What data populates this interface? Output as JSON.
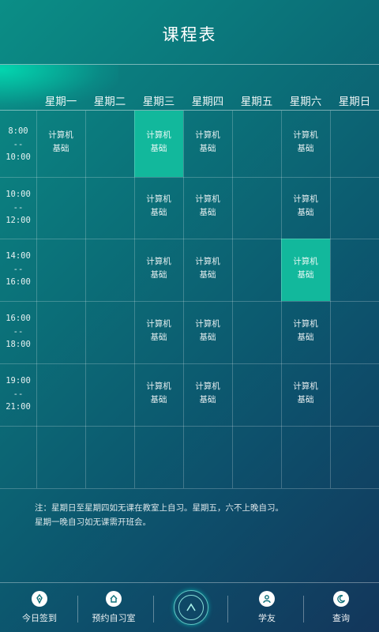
{
  "header": {
    "title": "课程表"
  },
  "days": [
    "星期一",
    "星期二",
    "星期三",
    "星期四",
    "星期五",
    "星期六",
    "星期日"
  ],
  "times": [
    {
      "start": "8:00",
      "sep": "--",
      "end": "10:00"
    },
    {
      "start": "10:00",
      "sep": "--",
      "end": "12:00"
    },
    {
      "start": "14:00",
      "sep": "--",
      "end": "16:00"
    },
    {
      "start": "16:00",
      "sep": "--",
      "end": "18:00"
    },
    {
      "start": "19:00",
      "sep": "--",
      "end": "21:00"
    }
  ],
  "course": {
    "line1": "计算机",
    "line2": "基础"
  },
  "schedule": {
    "row0": [
      "course",
      "",
      "course-highlight",
      "course",
      "",
      "course",
      ""
    ],
    "row1": [
      "",
      "",
      "course",
      "course",
      "",
      "course",
      ""
    ],
    "row2": [
      "",
      "",
      "course",
      "course",
      "",
      "course-highlight",
      ""
    ],
    "row3": [
      "",
      "",
      "course",
      "course",
      "",
      "course",
      ""
    ],
    "row4": [
      "",
      "",
      "course",
      "course",
      "",
      "course",
      ""
    ]
  },
  "note": {
    "line1": "注：星期日至星期四如无课在教室上自习。星期五，六不上晚自习。",
    "line2": "星期一晚自习如无课需开班会。"
  },
  "tabbar": {
    "checkin": {
      "label": "今日签到",
      "icon": "pen-icon"
    },
    "reserve": {
      "label": "预约自习室",
      "icon": "home-icon"
    },
    "center": {
      "icon": "chevron-up-icon"
    },
    "friends": {
      "label": "学友",
      "icon": "person-icon"
    },
    "query": {
      "label": "查询",
      "icon": "moon-icon"
    }
  },
  "colors": {
    "highlight": "#12b89c",
    "bg_start": "#0b8e86",
    "bg_end": "#13365b"
  }
}
